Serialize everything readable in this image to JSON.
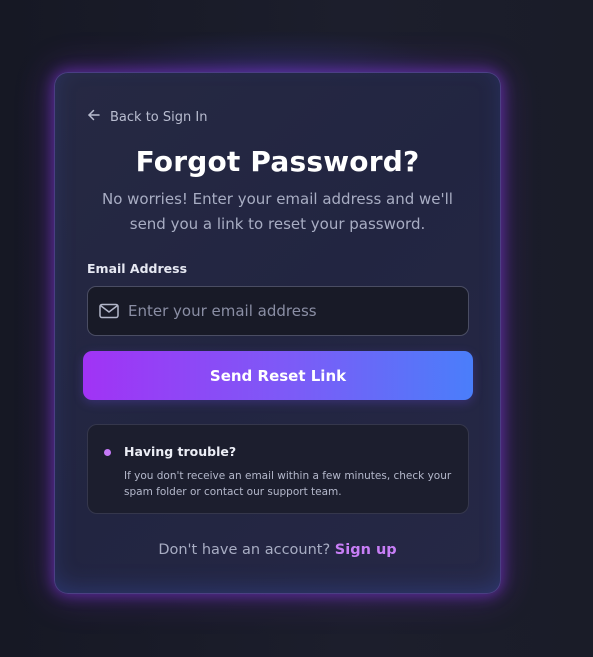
{
  "card": {
    "back_link": "Back to Sign In",
    "title": "Forgot Password?",
    "subtitle": "No worries! Enter your email address and we'll send you a link to reset your password.",
    "email": {
      "label": "Email Address",
      "placeholder": "Enter your email address",
      "value": "",
      "icon": "mail-icon"
    },
    "submit_label": "Send Reset Link",
    "help": {
      "title": "Having trouble?",
      "text": "If you don't receive an email within a few minutes, check your spam folder or contact our support team."
    },
    "signup_prompt": "Don't have an account?",
    "signup_link": "Sign up"
  },
  "colors": {
    "accent_purple": "#a133f5",
    "accent_blue": "#4a7efa",
    "link": "#c77ef6",
    "background": "#1a1c29",
    "card": "#242743"
  }
}
